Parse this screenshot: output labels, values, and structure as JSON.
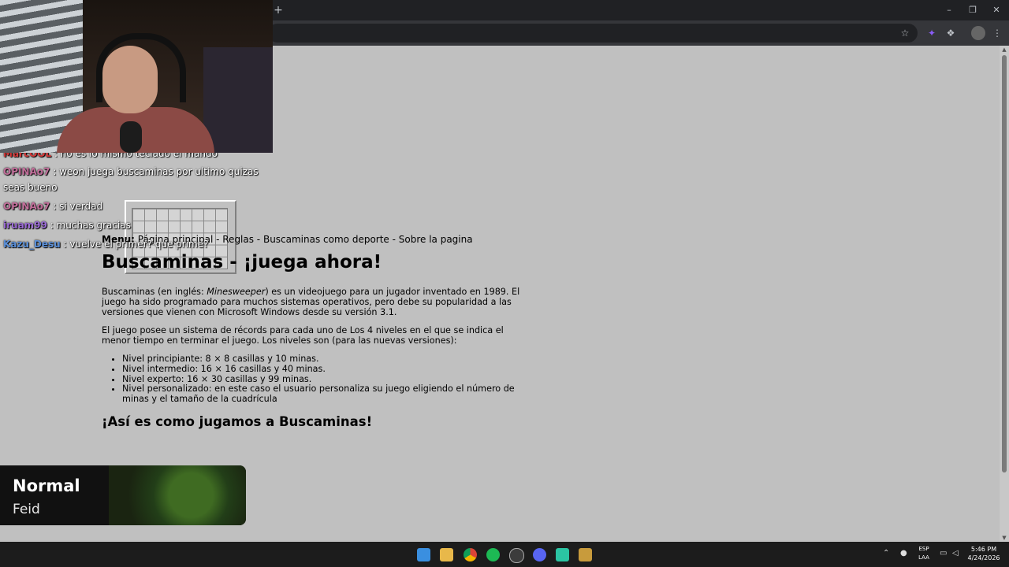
{
  "browser": {
    "new_tab_label": "+",
    "window_buttons": [
      "–",
      "❐",
      "✕"
    ],
    "toolbar_icons": [
      "star-icon",
      "extension-icon",
      "puzzle-icon",
      "profile-icon",
      "menu-icon"
    ]
  },
  "page": {
    "menu_label": "Menu:",
    "menu_items": "Página principal - Reglas - Buscaminas como deporte - Sobre la pagina",
    "title": "Buscaminas - ¡juega ahora!",
    "p1_pre": "Buscaminas (en inglés: ",
    "p1_em": "Minesweeper",
    "p1_post": ") es un videojuego para un jugador inventado en 1989. El juego ha sido programado para muchos sistemas operativos, pero debe su popularidad a las versiones que vienen con Microsoft Windows desde su versión 3.1.",
    "p2": "El juego posee un sistema de récords para cada uno de Los 4 niveles en el que se indica el menor tiempo en terminar el juego. Los niveles son (para las nuevas versiones):",
    "levels": [
      "Nivel principiante: 8 × 8 casillas y 10 minas.",
      "Nivel intermedio: 16 × 16 casillas y 40 minas.",
      "Nivel experto: 16 × 30 casillas y 99 minas.",
      "Nivel personalizado: en este caso el usuario personaliza su juego eligiendo el número de minas y el tamaño de la cuadrícula"
    ],
    "subtitle": "¡Así es como jugamos a Buscaminas!"
  },
  "chat": [
    {
      "user": "MarcOOL",
      "text": "no es lo mismo teclado el mando",
      "color": "#d43a3a"
    },
    {
      "user": "OPINAo7",
      "text": "weon juega buscaminas por ultimo quizas seas bueno",
      "color": "#c26e9a"
    },
    {
      "user": "OPINAo7",
      "text": "si verdad",
      "color": "#c26e9a"
    },
    {
      "user": "iruam99",
      "text": "muchas gracias",
      "color": "#9a6bd4"
    },
    {
      "user": "Kazu_Desu",
      "text": "vuelve el primer? que prime?",
      "color": "#5a8fd8"
    }
  ],
  "song": {
    "title": "Normal",
    "artist": "Feid"
  },
  "taskbar": {
    "apps": [
      "windows-start-icon",
      "file-explorer-icon",
      "chrome-icon",
      "spotify-icon",
      "obs-icon",
      "discord-icon",
      "app-icon",
      "league-icon"
    ],
    "lang_top": "ESP",
    "lang_bottom": "LAA",
    "time": "5:46 PM",
    "date": "4/24/2026"
  }
}
